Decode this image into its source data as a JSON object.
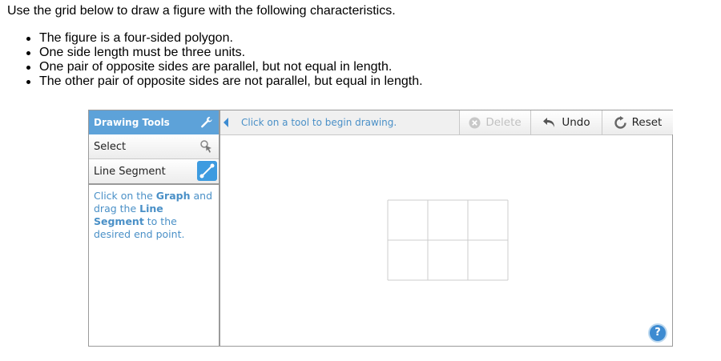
{
  "instructions": {
    "intro": "Use the grid below to draw a figure with the following characteristics.",
    "bullets": [
      "The figure is a four-sided polygon.",
      "One side length must be three units.",
      "One pair of opposite sides are parallel, but not equal in length.",
      "The other pair of opposite sides are not parallel, but equal in length."
    ]
  },
  "tools_panel": {
    "header": "Drawing Tools",
    "items": [
      {
        "label": "Select",
        "icon": "select-pointer-icon"
      },
      {
        "label": "Line Segment",
        "icon": "line-segment-icon"
      }
    ],
    "hint": {
      "p1": "Click on the ",
      "b1": "Graph",
      "p2": " and drag the ",
      "b2": "Line Segment",
      "p3": " to the desired end point."
    }
  },
  "toolbar": {
    "status": "Click on a tool to begin drawing.",
    "delete_label": "Delete",
    "undo_label": "Undo",
    "reset_label": "Reset"
  },
  "graph": {
    "columns": 3,
    "rows": 2
  },
  "help_label": "?",
  "colors": {
    "header_blue": "#5da2d9",
    "hint_text": "#4a90c7",
    "accent": "#3d8bd1"
  }
}
